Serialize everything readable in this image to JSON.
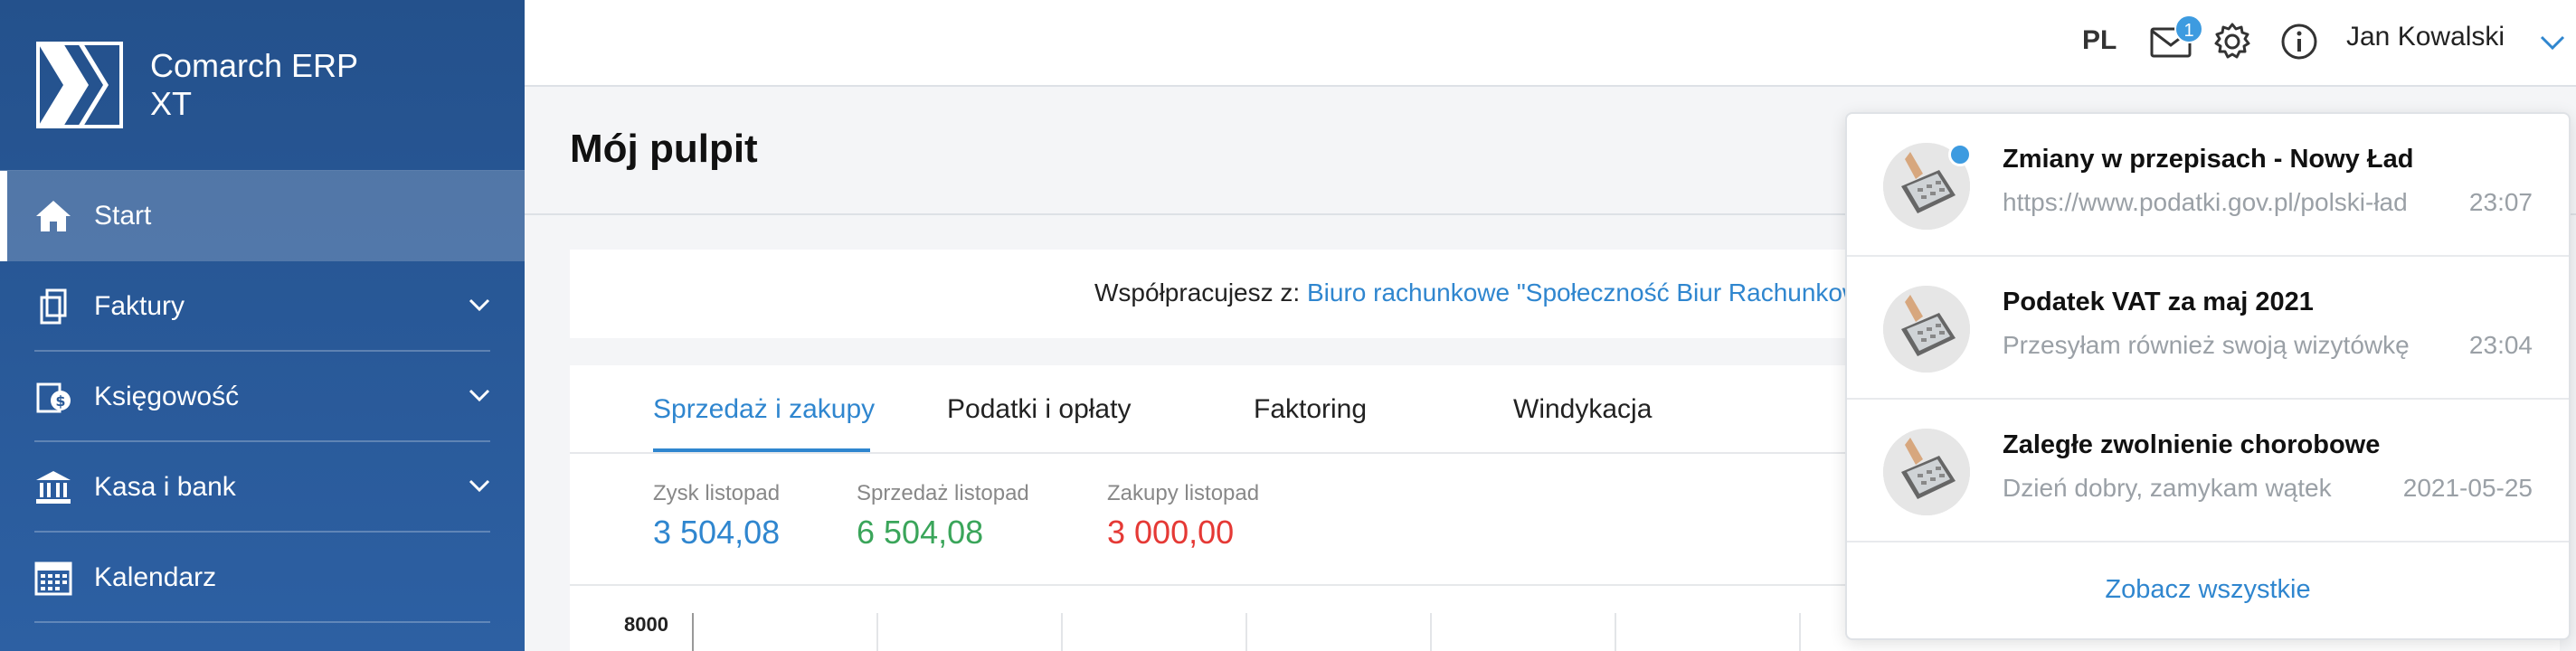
{
  "app": {
    "brand_line1": "Comarch ERP",
    "brand_line2": "XT"
  },
  "sidebar": {
    "items": [
      {
        "label": "Start",
        "icon": "home-icon",
        "active": true
      },
      {
        "label": "Faktury",
        "icon": "invoices-icon",
        "expandable": true
      },
      {
        "label": "Księgowość",
        "icon": "accounting-icon",
        "expandable": true
      },
      {
        "label": "Kasa i bank",
        "icon": "bank-icon",
        "expandable": true
      },
      {
        "label": "Kalendarz",
        "icon": "calendar-icon"
      }
    ]
  },
  "topbar": {
    "language": "PL",
    "mail_badge": "1",
    "user_name": "Jan Kowalski",
    "icons": [
      "mail-icon",
      "settings-icon",
      "info-icon",
      "chevron-down-icon"
    ]
  },
  "page": {
    "title": "Mój pulpit"
  },
  "collaboration": {
    "label": "Współpracujesz z:",
    "link": "Biuro rachunkowe \"Społeczność Biur Rachunkowych\""
  },
  "dashboard": {
    "tabs": [
      {
        "label": "Sprzedaż i zakupy",
        "active": true
      },
      {
        "label": "Podatki i opłaty"
      },
      {
        "label": "Faktoring"
      },
      {
        "label": "Windykacja"
      }
    ],
    "stats": [
      {
        "label": "Zysk listopad",
        "value": "3 504,08",
        "color": "#2f86cf"
      },
      {
        "label": "Sprzedaż listopad",
        "value": "6 504,08",
        "color": "#3aa55a"
      },
      {
        "label": "Zakupy listopad",
        "value": "3 000,00",
        "color": "#e53935"
      }
    ],
    "chart_axis_top": "8000"
  },
  "notifications": {
    "items": [
      {
        "title": "Zmiany w przepisach - Nowy Ład",
        "text": "https://www.podatki.gov.pl/polski-ład",
        "time": "23:07",
        "unread": true
      },
      {
        "title": "Podatek VAT za maj 2021",
        "text": "Przesyłam również swoją wizytówkę",
        "time": "23:04",
        "unread": false
      },
      {
        "title": "Zaległe zwolnienie chorobowe",
        "text": "Dzień dobry, zamykam wątek",
        "time": "2021-05-25",
        "unread": false
      }
    ],
    "see_all": "Zobacz wszystkie"
  },
  "colors": {
    "sidebar": "#2a5a98",
    "accent": "#2f86cf",
    "positive": "#3aa55a",
    "negative": "#e53935"
  }
}
